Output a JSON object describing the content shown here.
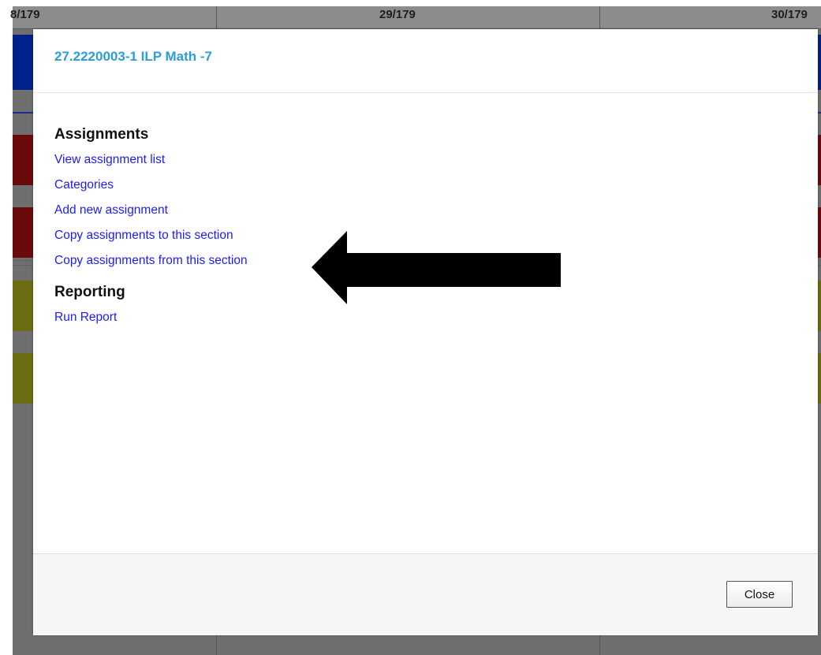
{
  "background": {
    "day_labels": [
      "8/179",
      "29/179",
      "30/179"
    ]
  },
  "modal": {
    "title": "27.2220003-1 ILP Math -7",
    "sections": [
      {
        "heading": "Assignments",
        "links": [
          "View assignment list",
          "Categories",
          "Add new assignment",
          "Copy assignments to this section",
          "Copy assignments from this section"
        ]
      },
      {
        "heading": "Reporting",
        "links": [
          "Run Report"
        ]
      }
    ],
    "close_label": "Close"
  },
  "colors": {
    "title": "#2a9fd6",
    "link": "#1a1aff",
    "overlay": "#6f6f6f"
  },
  "icons": {
    "annotation": "left-arrow-icon"
  }
}
